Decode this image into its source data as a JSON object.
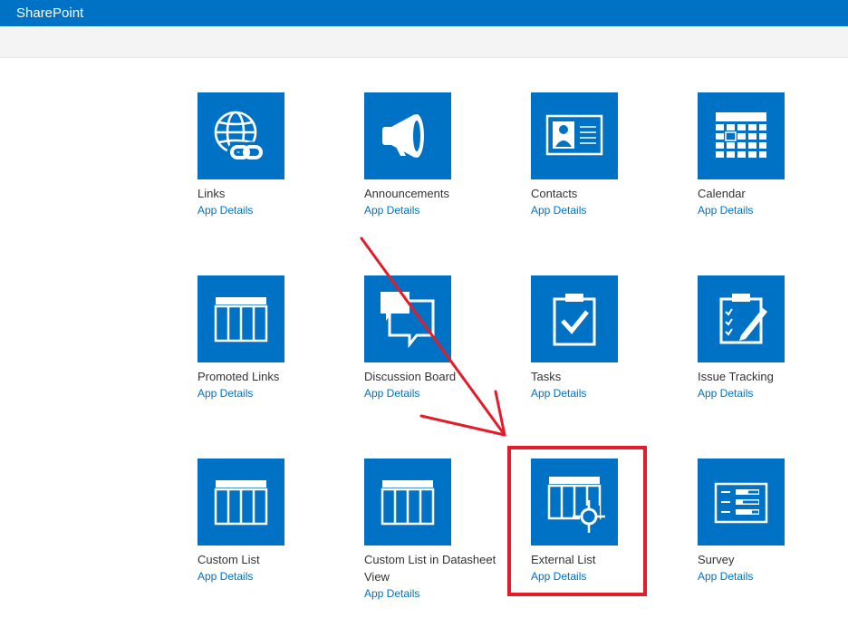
{
  "suite_bar": {
    "brand": "SharePoint"
  },
  "colors": {
    "tile_blue": "#0072c6",
    "annotation_red": "#e21c2a"
  },
  "apps": [
    {
      "name": "Links",
      "icon": "globe-link-icon",
      "details_label": "App Details"
    },
    {
      "name": "Announcements",
      "icon": "megaphone-icon",
      "details_label": "App Details"
    },
    {
      "name": "Contacts",
      "icon": "contact-card-icon",
      "details_label": "App Details"
    },
    {
      "name": "Calendar",
      "icon": "calendar-icon",
      "details_label": "App Details"
    },
    {
      "name": "Promoted Links",
      "icon": "list-grid-icon",
      "details_label": "App Details"
    },
    {
      "name": "Discussion Board",
      "icon": "speech-bubbles-icon",
      "details_label": "App Details"
    },
    {
      "name": "Tasks",
      "icon": "clipboard-check-icon",
      "details_label": "App Details"
    },
    {
      "name": "Issue Tracking",
      "icon": "clipboard-pencil-icon",
      "details_label": "App Details"
    },
    {
      "name": "Custom List",
      "icon": "list-grid-icon",
      "details_label": "App Details"
    },
    {
      "name": "Custom List in Datasheet View",
      "icon": "list-grid-icon",
      "details_label": "App Details"
    },
    {
      "name": "External List",
      "icon": "external-list-icon",
      "details_label": "App Details"
    },
    {
      "name": "Survey",
      "icon": "survey-form-icon",
      "details_label": "App Details"
    }
  ]
}
